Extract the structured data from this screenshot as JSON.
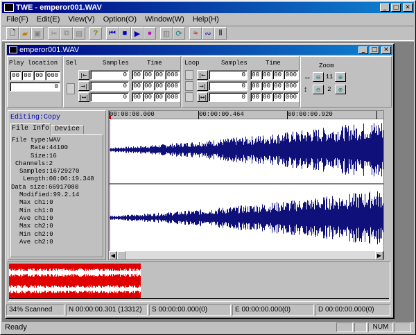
{
  "app": {
    "title": "TWE - emperor001.WAV"
  },
  "menu": [
    "File(F)",
    "Edit(E)",
    "View(V)",
    "Option(O)",
    "Window(W)",
    "Help(H)"
  ],
  "doc": {
    "title": "emperor001.WAV"
  },
  "play": {
    "label": "Play location",
    "hh": "00",
    "mm": "00",
    "ss": "00",
    "ms": "000",
    "samples": "0"
  },
  "sel": {
    "label": "Sel",
    "samples_hdr": "Samples",
    "time_hdr": "Time",
    "rows": [
      {
        "samples": "0",
        "t": [
          "00",
          "00",
          "00",
          "000"
        ]
      },
      {
        "samples": "0",
        "t": [
          "00",
          "00",
          "00",
          "000"
        ]
      },
      {
        "samples": "0",
        "t": [
          "00",
          "00",
          "00",
          "000"
        ]
      }
    ]
  },
  "loop": {
    "label": "Loop",
    "samples_hdr": "Samples",
    "time_hdr": "Time",
    "rows": [
      {
        "samples": "0",
        "t": [
          "00",
          "00",
          "00",
          "000"
        ]
      },
      {
        "samples": "0",
        "t": [
          "00",
          "00",
          "00",
          "000"
        ]
      },
      {
        "samples": "0",
        "t": [
          "00",
          "00",
          "00",
          "000"
        ]
      }
    ]
  },
  "zoom": {
    "label": "Zoom",
    "h": "11",
    "v": "2"
  },
  "info": {
    "editing": "Editing:Copy",
    "tab_file": "File Info",
    "tab_device": "Device",
    "lines": [
      "File type:WAV",
      "Rate:44100",
      "Size:16",
      "Channels:2",
      "Samples:16729270",
      "Length:00:06:19.348",
      "Data size:66917080",
      "Modified:99.2.14",
      "Max ch1:0",
      "Min ch1:0",
      "Ave ch1:0",
      "Max ch2:0",
      "Min ch2:0",
      "Ave ch2:0"
    ]
  },
  "ruler": [
    "00:00:00.000",
    "00:00:00.464",
    "00:00:00.920"
  ],
  "status": {
    "scanned": "34% Scanned",
    "n": "N 00:00:00.301 (13312)",
    "s": "S 00:00:00.000(0)",
    "e": "E 00:00:00.000(0)",
    "d": "D 00:00:00.000(0)"
  },
  "bottom": {
    "ready": "Ready",
    "num": "NUM"
  }
}
